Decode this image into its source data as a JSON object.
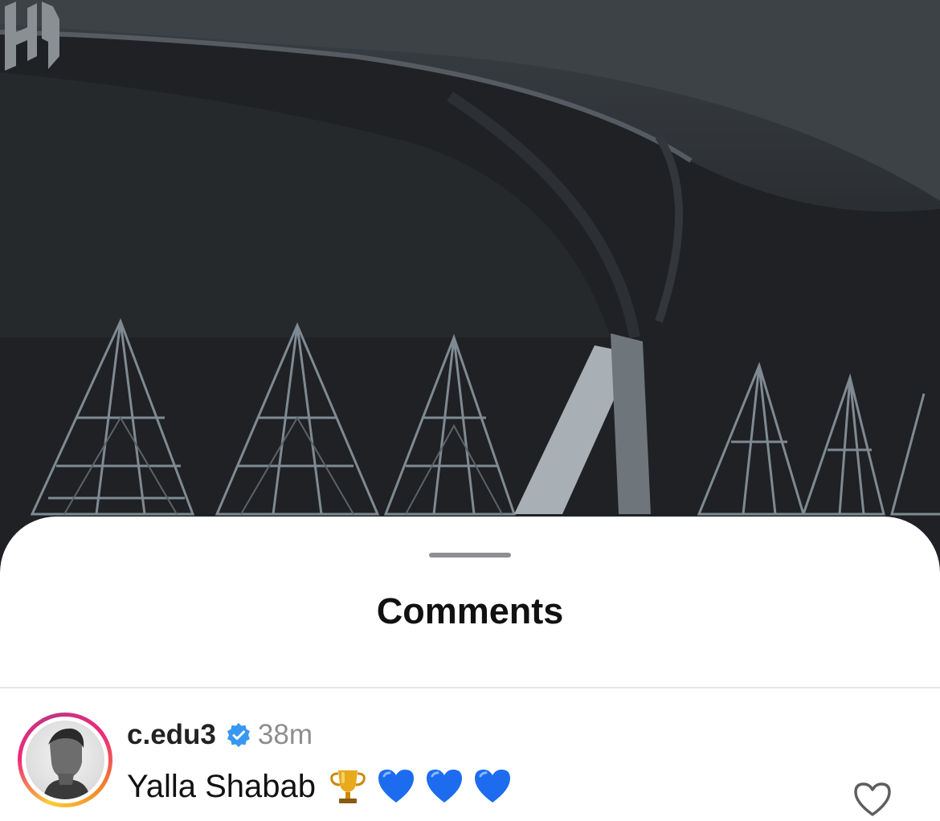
{
  "post": {
    "logo_icon": "alhilal-logo-icon",
    "image_description_tag": "stadium-roof-photo"
  },
  "sheet": {
    "title": "Comments"
  },
  "comments": [
    {
      "username": "c.edu3",
      "verified": true,
      "time": "38m",
      "text": "Yalla Shabab",
      "emojis": [
        "trophy",
        "blue-heart",
        "blue-heart",
        "blue-heart"
      ],
      "liked": false
    }
  ],
  "colors": {
    "verified_blue": "#3897f0",
    "heart_blue": "#1d6cf0",
    "secondary_text": "#8e8e8e"
  }
}
